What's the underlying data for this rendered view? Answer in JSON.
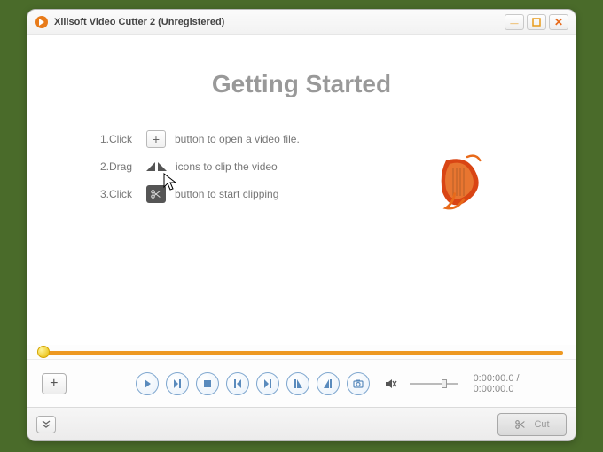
{
  "window": {
    "title": "Xilisoft Video Cutter 2 (Unregistered)"
  },
  "heading": "Getting Started",
  "steps": {
    "s1_lead": "1.Click",
    "s1_tail": "button to open a video file.",
    "s2_lead": "2.Drag",
    "s2_tail": "icons to clip the video",
    "s3_lead": "3.Click",
    "s3_tail": "button to start clipping"
  },
  "icons": {
    "plus": "+",
    "marker_left": "◣",
    "marker_right": "◢"
  },
  "player": {
    "time_current": "0:00:00.0",
    "time_total": "0:00:00.0",
    "time_sep": " / "
  },
  "footer": {
    "cut_label": "Cut"
  },
  "colors": {
    "accent": "#ee9922",
    "button_ring": "#7fa7cf"
  }
}
